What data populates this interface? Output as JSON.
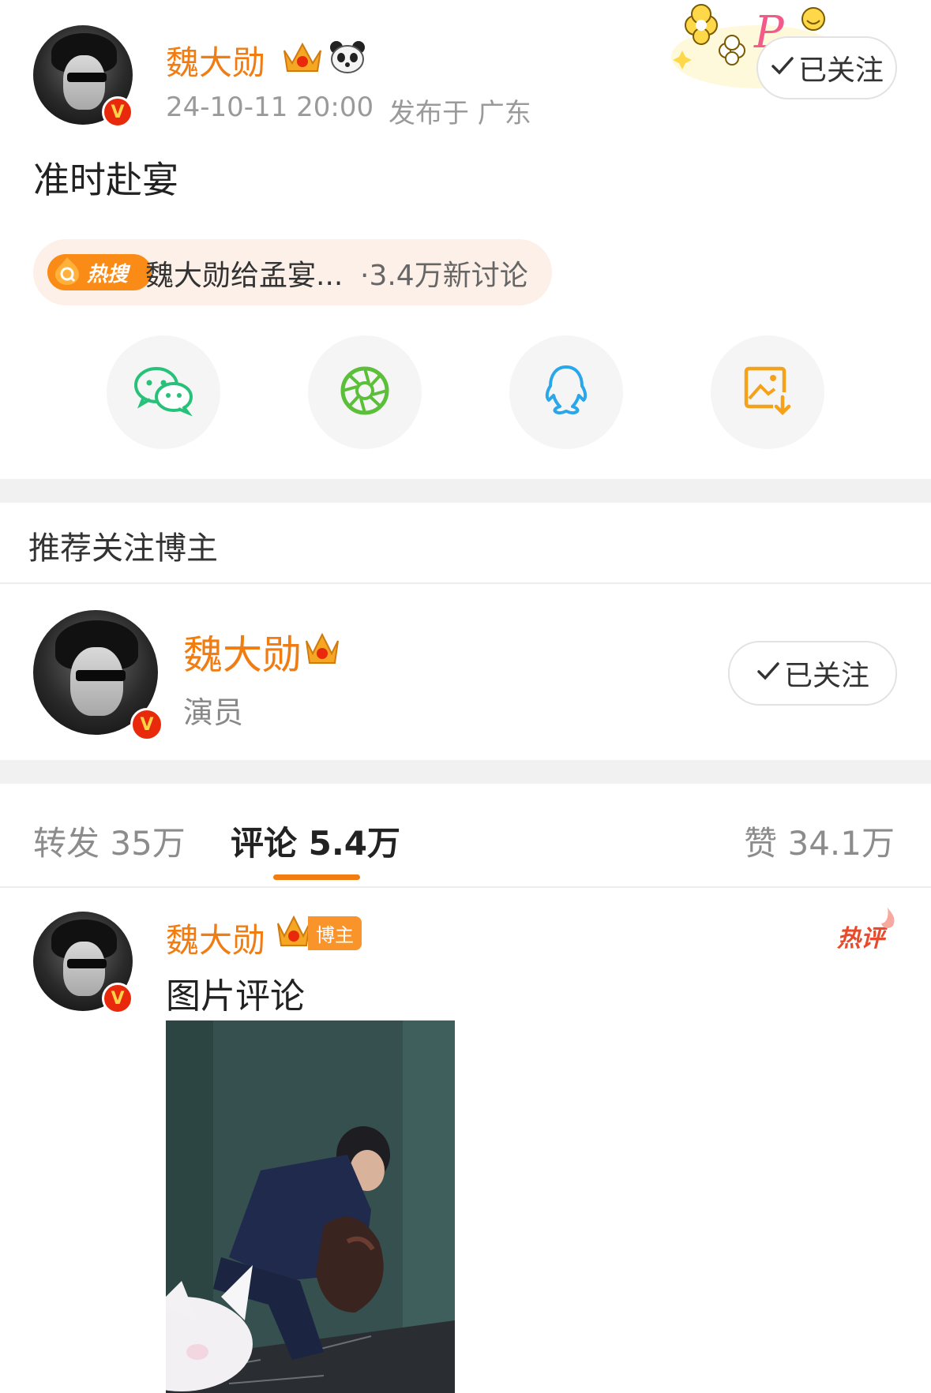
{
  "post": {
    "author_name": "魏大勋",
    "timestamp": "24-10-11 20:00",
    "location": "发布于 广东",
    "follow_label": "已关注",
    "text": "准时赴宴",
    "hot_tag": {
      "badge": "热搜",
      "topic": "魏大勋给孟宴...",
      "count": "·3.4万新讨论"
    }
  },
  "share": {
    "icons": [
      "wechat-icon",
      "moments-icon",
      "qq-icon",
      "save-image-icon"
    ]
  },
  "recommend": {
    "section_title": "推荐关注博主",
    "name": "魏大勋",
    "desc": "演员",
    "follow_label": "已关注"
  },
  "stats": {
    "repost": "转发 35万",
    "comment": "评论 5.4万",
    "like": "赞 34.1万"
  },
  "comment": {
    "author_name": "魏大勋",
    "badge": "博主",
    "hot_label": "热评",
    "text": "图片评论"
  },
  "colors": {
    "brand_orange": "#f07c12",
    "badge_red": "#e8290b",
    "hot_red": "#e84a2c"
  }
}
